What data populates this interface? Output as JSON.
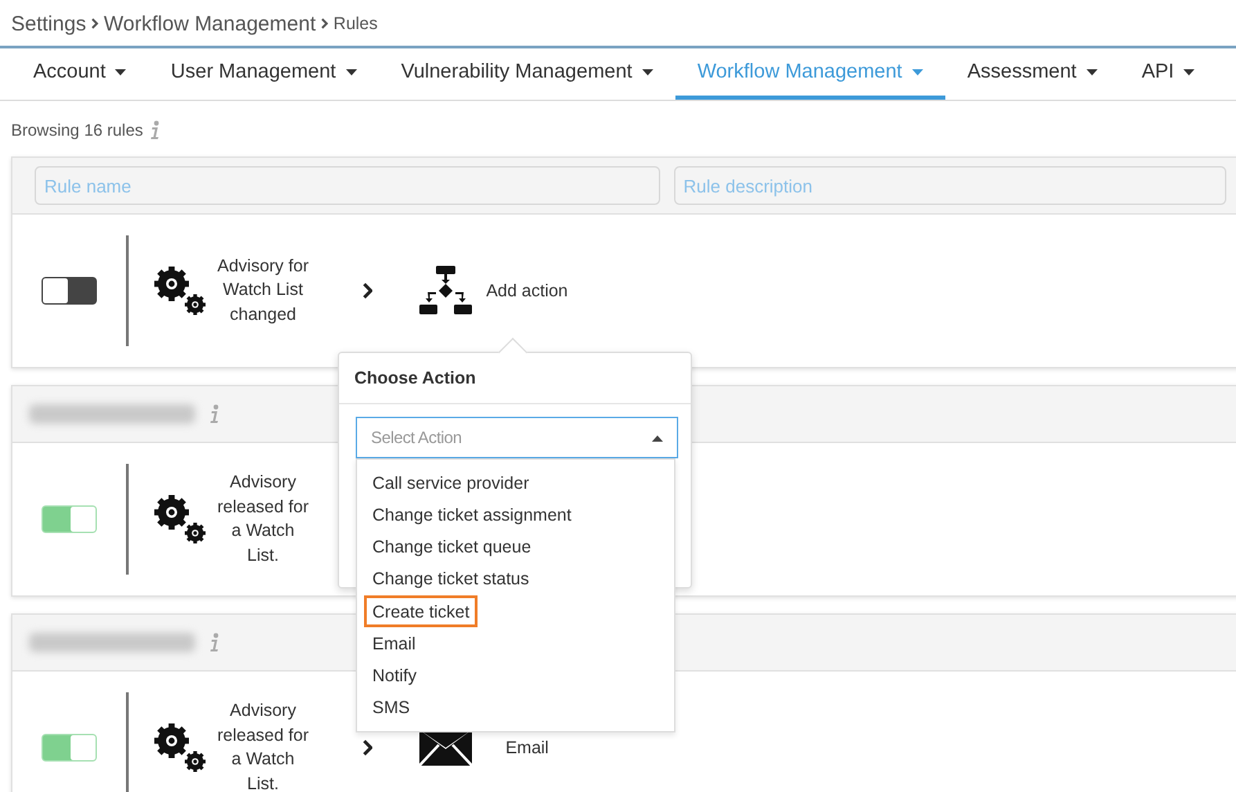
{
  "breadcrumb": [
    {
      "label": "Settings"
    },
    {
      "label": "Workflow Management"
    },
    {
      "label": "Rules"
    }
  ],
  "tabs": [
    {
      "label": "Account",
      "selected": false
    },
    {
      "label": "User Management",
      "selected": false
    },
    {
      "label": "Vulnerability Management",
      "selected": false
    },
    {
      "label": "Workflow Management",
      "selected": true
    },
    {
      "label": "Assessment",
      "selected": false
    },
    {
      "label": "API",
      "selected": false
    }
  ],
  "summary": "Browsing 16 rules",
  "filters": {
    "rule_name": {
      "placeholder": "Rule name"
    },
    "rule_description": {
      "placeholder": "Rule description"
    }
  },
  "rules": [
    {
      "redacted_name": false,
      "on": false,
      "trigger": "Advisory for Watch List changed",
      "action": {
        "kind": "add",
        "label": "Add action"
      }
    },
    {
      "redacted_name": true,
      "on": true,
      "trigger": "Advisory released for a Watch List."
    },
    {
      "redacted_name": true,
      "on": true,
      "trigger": "Advisory released for a Watch List.",
      "action": {
        "kind": "email",
        "label": "Email"
      }
    }
  ],
  "popover": {
    "title": "Choose Action",
    "select": {
      "placeholder": "Select Action",
      "expanded": true
    },
    "options": [
      {
        "label": "Call service provider",
        "selected": false
      },
      {
        "label": "Change ticket assignment",
        "selected": false
      },
      {
        "label": "Change ticket queue",
        "selected": false
      },
      {
        "label": "Change ticket status",
        "selected": false
      },
      {
        "label": "Create ticket",
        "selected": true
      },
      {
        "label": "Email",
        "selected": false
      },
      {
        "label": "Notify",
        "selected": false
      },
      {
        "label": "SMS",
        "selected": false
      }
    ]
  }
}
